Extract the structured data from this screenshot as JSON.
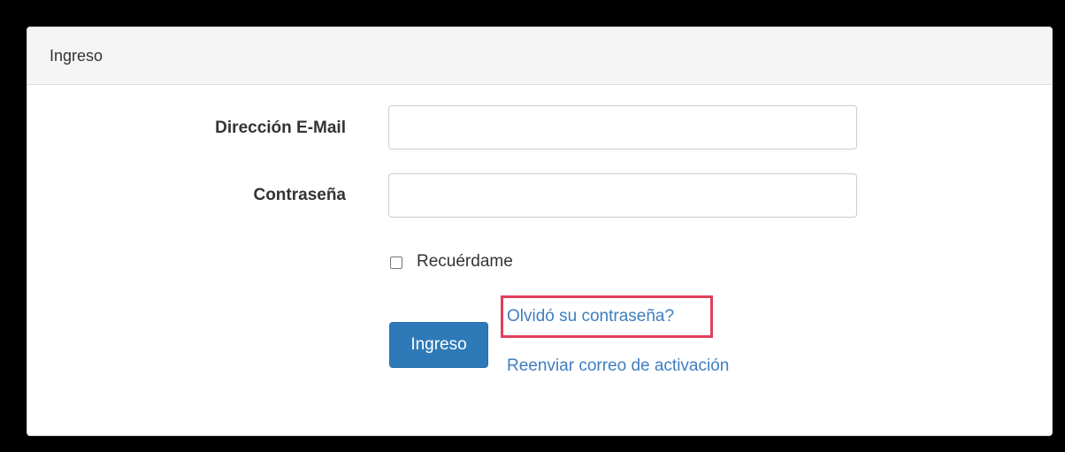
{
  "panel": {
    "title": "Ingreso"
  },
  "form": {
    "email_label": "Dirección E-Mail",
    "email_value": "",
    "password_label": "Contraseña",
    "password_value": "",
    "remember_label": "Recuérdame",
    "remember_checked": false,
    "submit_label": "Ingreso",
    "forgot_link": "Olvidó su contraseña?",
    "resend_link": "Reenviar correo de activación"
  },
  "colors": {
    "primary_button": "#2e7ab8",
    "link": "#3f7ec0",
    "highlight_border": "#e0405a"
  }
}
